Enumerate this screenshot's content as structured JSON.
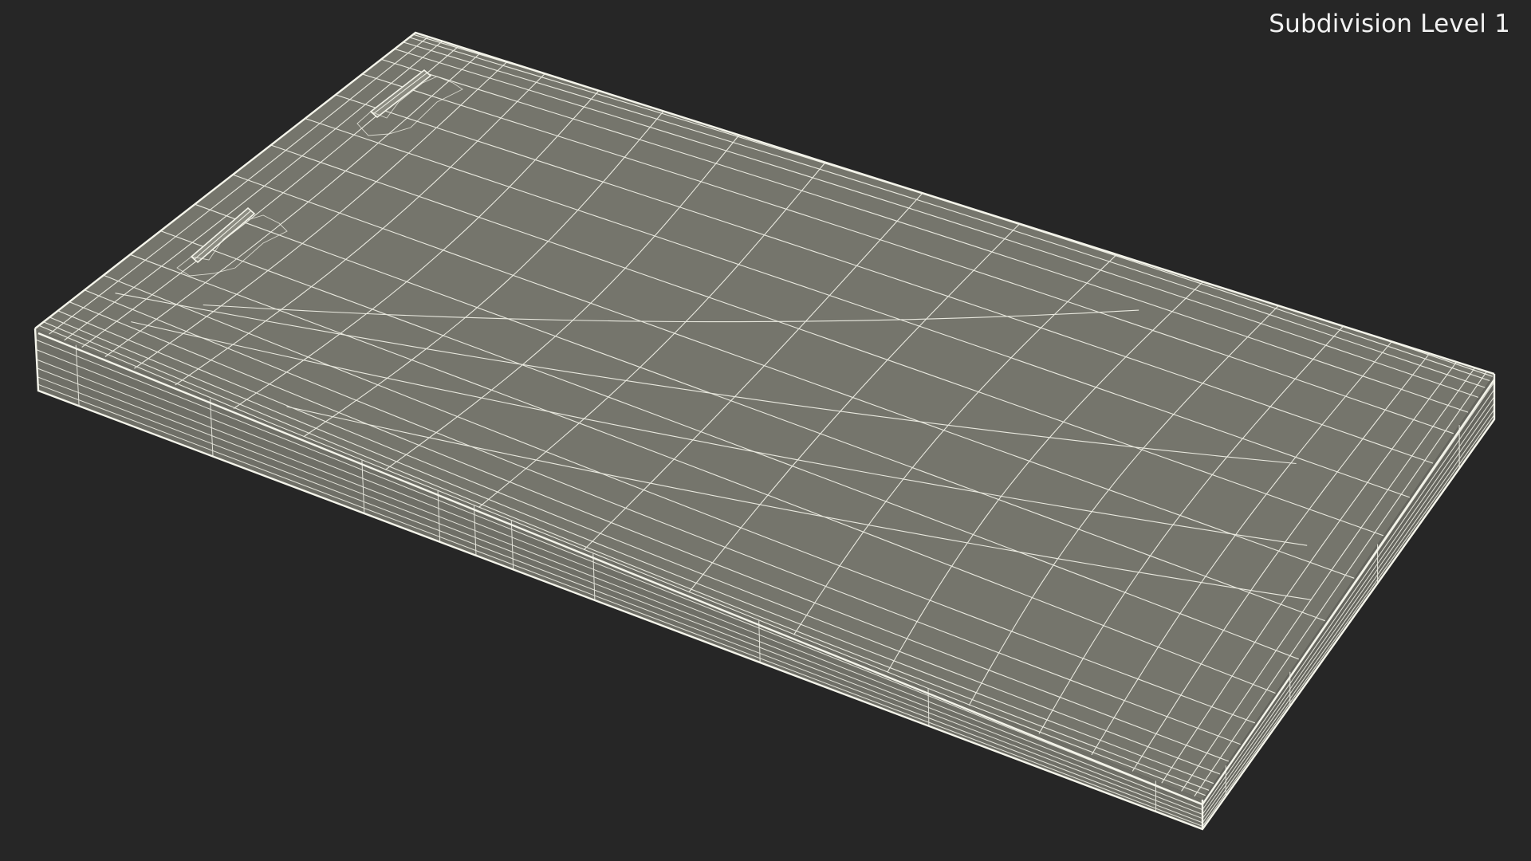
{
  "viewport": {
    "subdivision_label": "Subdivision Level 1"
  },
  "colors": {
    "background": "#262626",
    "top_face": "#75756c",
    "front_face": "#6f6f67",
    "side_face": "#66665f",
    "wire": "#f0f0e6",
    "label_text": "#f2f2f2"
  }
}
